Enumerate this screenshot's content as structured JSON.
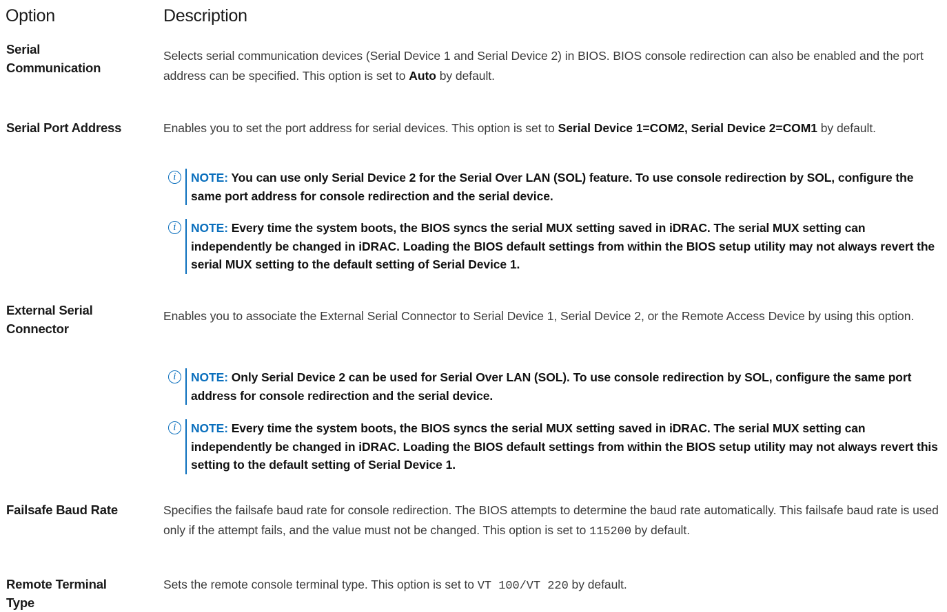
{
  "header": {
    "option": "Option",
    "description": "Description"
  },
  "rows": {
    "serial_comm": {
      "option": "Serial Communication",
      "desc_text": "Selects serial communication devices (Serial Device 1 and Serial Device 2) in BIOS. BIOS console redirection can also be enabled and the port address can be specified. This option is set to ",
      "desc_bold": "Auto",
      "desc_tail": " by default."
    },
    "serial_port": {
      "option": "Serial Port Address",
      "desc_text": "Enables you to set the port address for serial devices. This option is set to ",
      "desc_bold": "Serial Device 1=COM2, Serial Device 2=COM1",
      "desc_tail": " by default.",
      "note1": "You can use only Serial Device 2 for the Serial Over LAN (SOL) feature. To use console redirection by SOL, configure the same port address for console redirection and the serial device.",
      "note2": "Every time the system boots, the BIOS syncs the serial MUX setting saved in iDRAC. The serial MUX setting can independently be changed in iDRAC. Loading the BIOS default settings from within the BIOS setup utility may not always revert the serial MUX setting to the default setting of Serial Device 1."
    },
    "ext_serial": {
      "option": "External Serial Connector",
      "desc": "Enables you to associate the External Serial Connector to Serial Device 1, Serial Device 2, or the Remote Access Device by using this option.",
      "note1": "Only Serial Device 2 can be used for Serial Over LAN (SOL). To use console redirection by SOL, configure the same port address for console redirection and the serial device.",
      "note2": "Every time the system boots, the BIOS syncs the serial MUX setting saved in iDRAC. The serial MUX setting can independently be changed in iDRAC. Loading the BIOS default settings from within the BIOS setup utility may not always revert this setting to the default setting of Serial Device 1."
    },
    "failsafe": {
      "option": "Failsafe Baud Rate",
      "desc_text": "Specifies the failsafe baud rate for console redirection. The BIOS attempts to determine the baud rate automatically. This failsafe baud rate is used only if the attempt fails, and the value must not be changed. This option is set to ",
      "desc_code": "115200",
      "desc_tail": " by default."
    },
    "remote_term": {
      "option": "Remote Terminal Type",
      "desc_text": "Sets the remote console terminal type. This option is set to ",
      "desc_code": "VT 100/VT 220",
      "desc_tail": " by default."
    }
  },
  "note_label": "NOTE:",
  "note_icon": "info-circle-icon",
  "colors": {
    "accent": "#0a6fbd",
    "text": "#1a1a1a",
    "body_text": "#3a3a3a"
  }
}
